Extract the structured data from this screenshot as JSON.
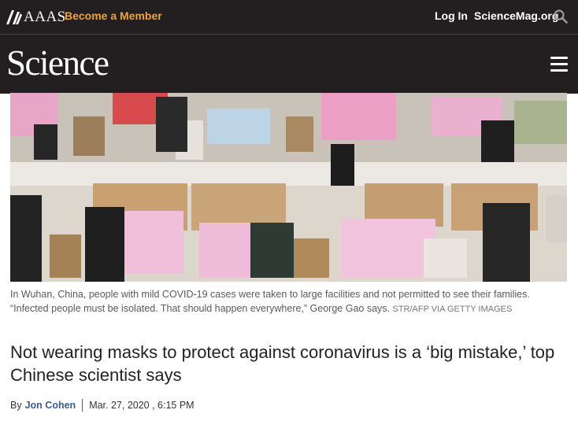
{
  "topbar": {
    "org": "AAAS",
    "member_link": "Become a Member",
    "login": "Log In",
    "site_link": "ScienceMag.org",
    "search_icon": "search-icon"
  },
  "header": {
    "logo": "Science",
    "menu_icon": "hamburger-menu-icon"
  },
  "photo": {
    "alt": "Wuhan quarantine facility photo"
  },
  "caption": {
    "text": "In Wuhan, China, people with mild COVID-19 cases were taken to large facilities and not permitted to see their families. “Infected people must be isolated. That should happen everywhere,” George Gao says.",
    "credit": "STR/AFP VIA GETTY IMAGES"
  },
  "article": {
    "headline": "Not wearing masks to protect against coronavirus is a ‘big mistake,’ top Chinese scientist says",
    "by": "By",
    "author": "Jon Cohen",
    "date": "Mar. 27, 2020 , 6:15 PM"
  },
  "colors": {
    "header_bg": "#231f20",
    "member_accent": "#f0a23a",
    "author_link": "#3d5f86"
  }
}
